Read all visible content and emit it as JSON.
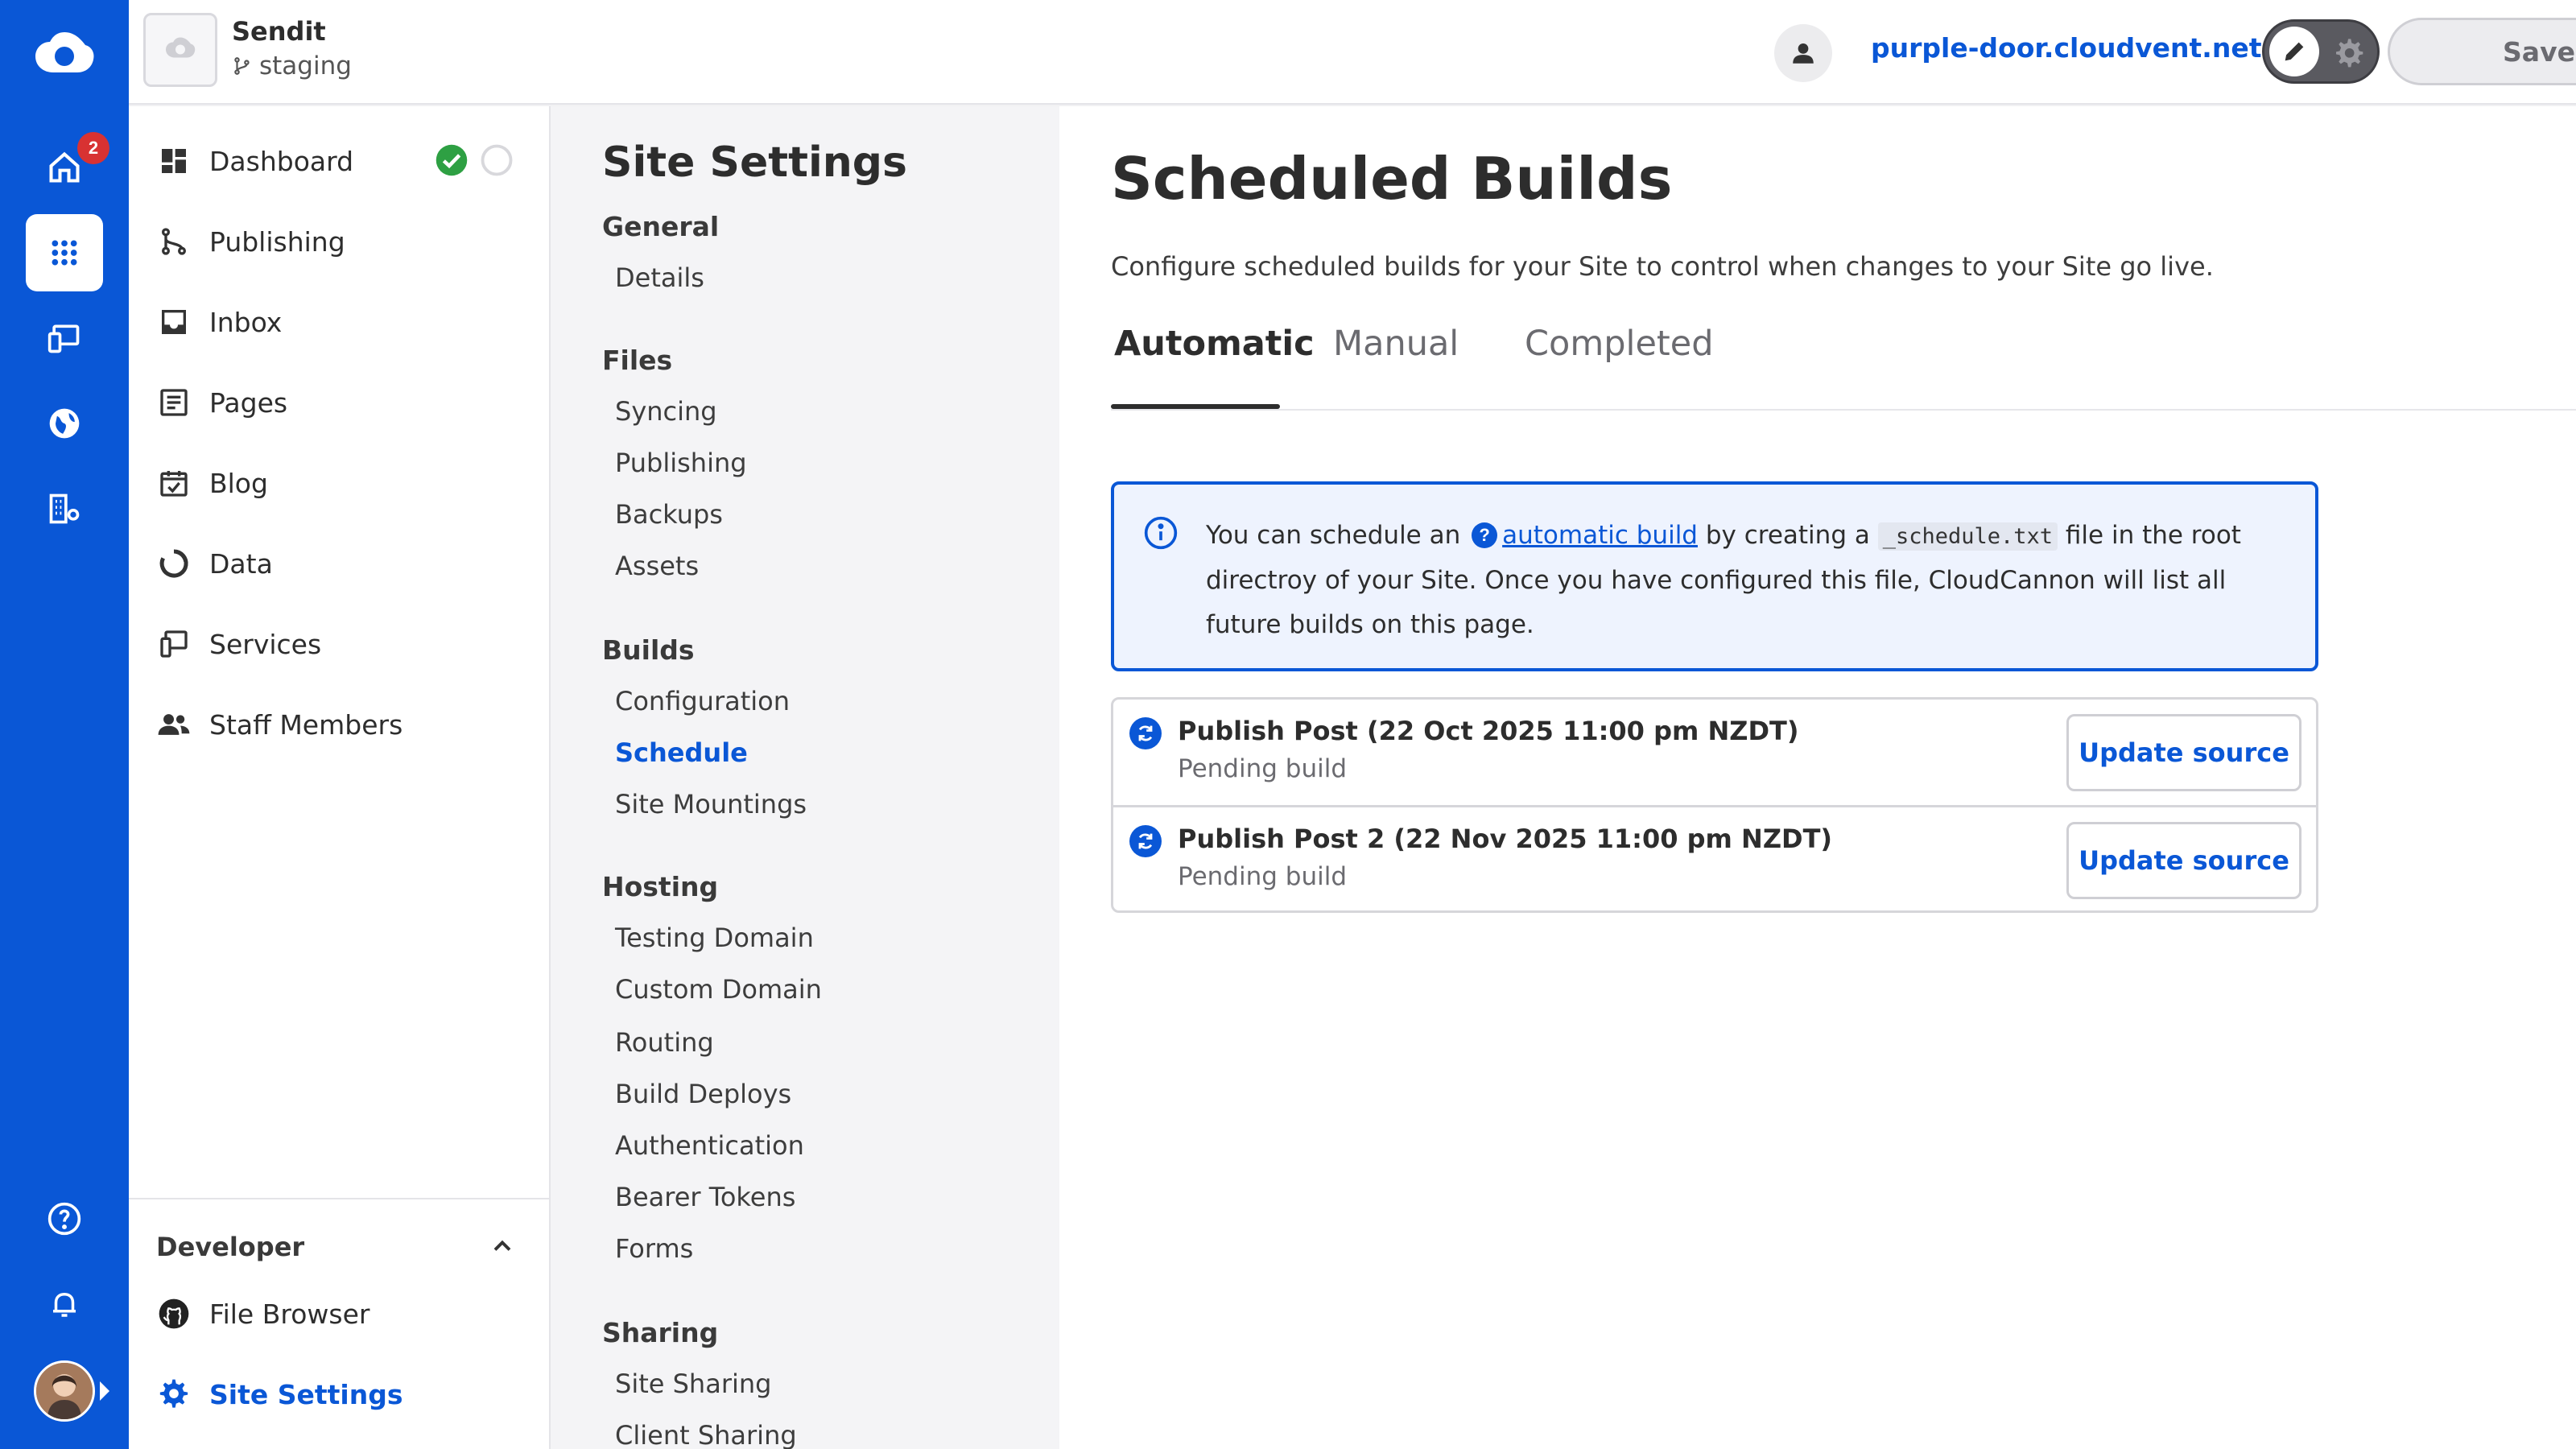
{
  "site": {
    "name": "Sendit",
    "branch": "staging"
  },
  "rail": {
    "home_badge": "2"
  },
  "topbar": {
    "domain": "purple-door.cloudvent.net",
    "save_label": "Save"
  },
  "nav": {
    "items": [
      {
        "label": "Dashboard"
      },
      {
        "label": "Publishing"
      },
      {
        "label": "Inbox"
      },
      {
        "label": "Pages"
      },
      {
        "label": "Blog"
      },
      {
        "label": "Data"
      },
      {
        "label": "Services"
      },
      {
        "label": "Staff Members"
      }
    ],
    "developer": {
      "title": "Developer",
      "items": [
        {
          "label": "File Browser"
        },
        {
          "label": "Site Settings"
        }
      ]
    }
  },
  "settings": {
    "title": "Site Settings",
    "groups": [
      {
        "label": "General",
        "links": [
          "Details"
        ]
      },
      {
        "label": "Files",
        "links": [
          "Syncing",
          "Publishing",
          "Backups",
          "Assets"
        ]
      },
      {
        "label": "Builds",
        "links": [
          "Configuration",
          "Schedule",
          "Site Mountings"
        ]
      },
      {
        "label": "Hosting",
        "links": [
          "Testing Domain",
          "Custom Domain",
          "Routing",
          "Build Deploys",
          "Authentication",
          "Bearer Tokens",
          "Forms"
        ]
      },
      {
        "label": "Sharing",
        "links": [
          "Site Sharing",
          "Client Sharing"
        ]
      }
    ]
  },
  "content": {
    "title": "Scheduled Builds",
    "description": "Configure scheduled builds for your Site to control when changes to your Site go live.",
    "tabs": [
      "Automatic",
      "Manual",
      "Completed"
    ],
    "info": {
      "prefix": "You can schedule an",
      "help_icon": "?",
      "link": "automatic build",
      "middle": "by creating a",
      "code": "_schedule.txt",
      "suffix": "file in the root directroy of your Site. Once you have configured this file, CloudCannon will list all future builds on this page."
    },
    "builds": [
      {
        "title": "Publish Post (22 Oct 2025 11:00 pm NZDT)",
        "status": "Pending build",
        "action": "Update source"
      },
      {
        "title": "Publish Post 2 (22 Nov 2025 11:00 pm NZDT)",
        "status": "Pending build",
        "action": "Update source"
      }
    ]
  },
  "colors": {
    "brand": "#0a57d6",
    "success": "#2ea043",
    "badge": "#d83232"
  }
}
